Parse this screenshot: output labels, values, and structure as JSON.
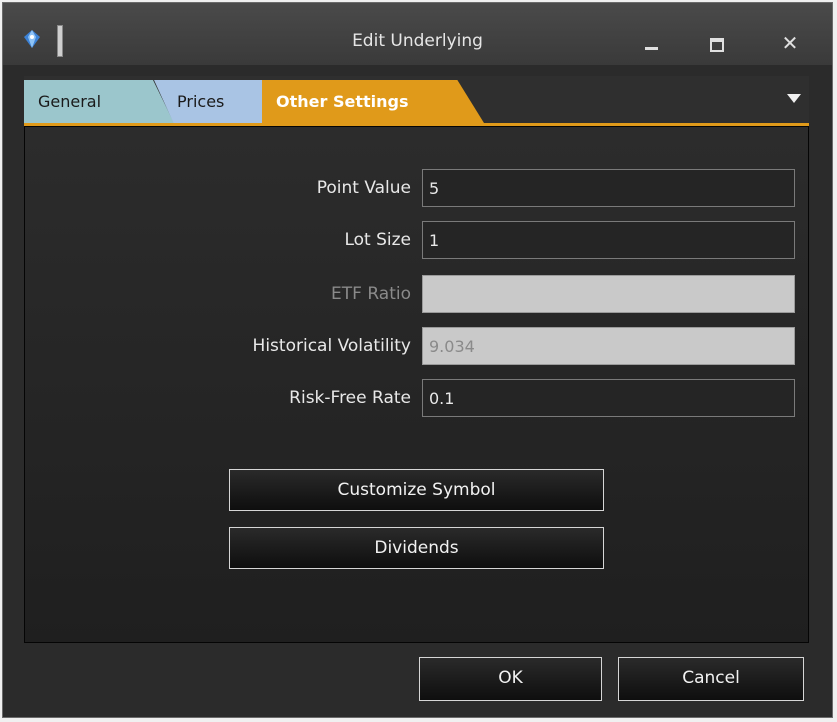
{
  "window": {
    "title": "Edit Underlying"
  },
  "tabs": [
    {
      "label": "General",
      "active": false
    },
    {
      "label": "Prices",
      "active": false
    },
    {
      "label": "Other Settings",
      "active": true
    }
  ],
  "fields": {
    "point_value": {
      "label": "Point Value",
      "value": "5",
      "enabled": true
    },
    "lot_size": {
      "label": "Lot Size",
      "value": "1",
      "enabled": true
    },
    "etf_ratio": {
      "label": "ETF Ratio",
      "value": "",
      "enabled": false
    },
    "historical_volatility": {
      "label": "Historical Volatility",
      "value": "9.034",
      "enabled": false
    },
    "risk_free_rate": {
      "label": "Risk-Free Rate",
      "value": "0.1",
      "enabled": true
    }
  },
  "buttons": {
    "customize_symbol": "Customize Symbol",
    "dividends": "Dividends",
    "ok": "OK",
    "cancel": "Cancel"
  },
  "colors": {
    "accent": "#e09a1a",
    "tab_general": "#9bc6cc",
    "tab_prices": "#a9c4e4",
    "panel_bg": "#262626"
  },
  "icons": {
    "app": "app-logo-icon",
    "minimize": "minimize-icon",
    "maximize": "maximize-icon",
    "close": "close-icon",
    "tab_menu": "chevron-down-icon"
  }
}
